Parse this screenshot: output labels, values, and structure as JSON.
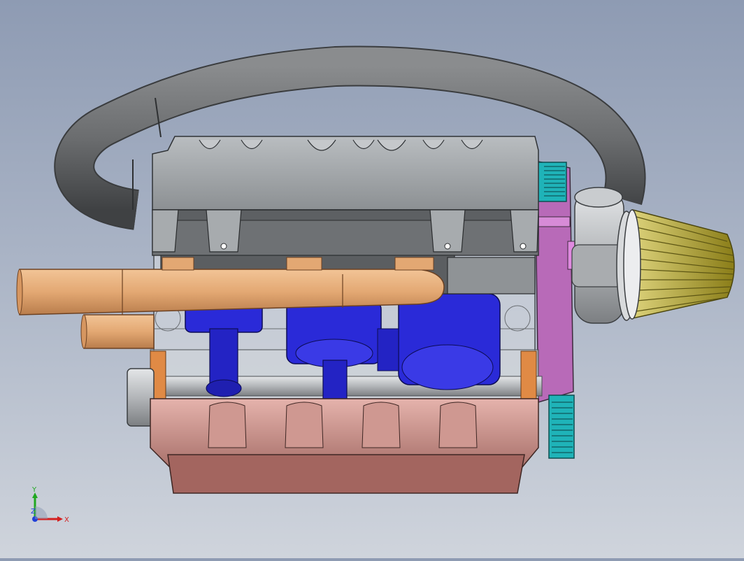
{
  "viewport": {
    "background_top": "#8e9bb3",
    "background_bottom": "#cfd4dc"
  },
  "model": {
    "colors": {
      "intake_hose": "#6b6d6f",
      "cam_cover": "#9ea3a6",
      "exhaust_pipe": "#e3a873",
      "pistons": "#2a2ad8",
      "oil_pan": "#d9a39c",
      "timing_cover": "#b86ab8",
      "air_filter": "#b8a82a",
      "timing_pulley": "#1fb3b8",
      "crank_pulley": "#b7b9bb"
    }
  },
  "triad": {
    "x_label": "X",
    "y_label": "Y",
    "z_label": "Z",
    "x_color": "#d42020",
    "y_color": "#20a820",
    "z_color": "#2040d8"
  }
}
